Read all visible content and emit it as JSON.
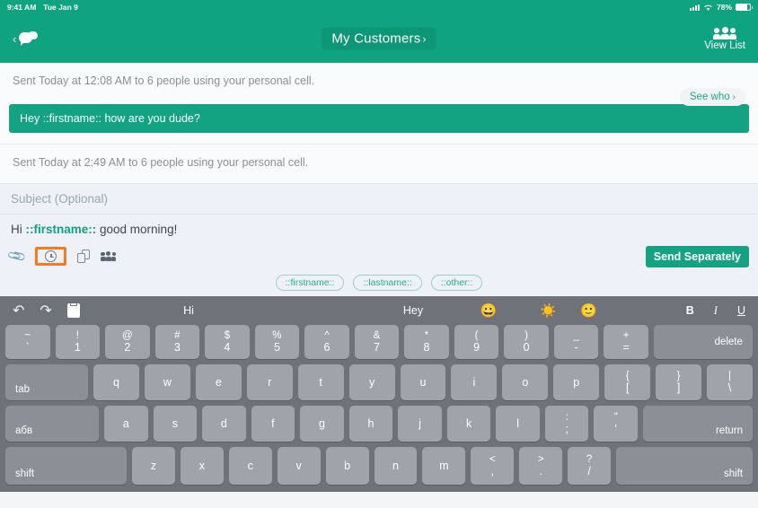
{
  "status_bar": {
    "time": "9:41 AM",
    "date": "Tue Jan 9",
    "battery_percent": "78%",
    "battery_level": 78,
    "signal_icon": "cellular-signal-icon",
    "wifi_icon": "wifi-icon"
  },
  "header": {
    "back_icon": "chevron-left-icon",
    "messages_icon": "chat-bubbles-icon",
    "title": "My Customers",
    "title_chevron": "›",
    "view_list_label": "View List",
    "view_list_icon": "people-group-icon",
    "accent_color": "#0fa37f"
  },
  "thread": {
    "entries": [
      {
        "sent_text": "Sent Today at 12:08 AM to 6 people using your personal cell.",
        "see_who_label": "See who",
        "see_who_chevron": "›",
        "message": "Hey ::firstname:: how are you dude?"
      },
      {
        "sent_text": "Sent Today at 2:49 AM to 6 people using your personal cell."
      }
    ]
  },
  "composer": {
    "subject_placeholder": "Subject (Optional)",
    "subject_value": "",
    "message_parts": {
      "before": "Hi ",
      "merge_field": "::firstname::",
      "after": " good morning!"
    },
    "tools": [
      {
        "name": "attach-icon",
        "label": "attach"
      },
      {
        "name": "schedule-clock-icon",
        "label": "schedule",
        "highlighted": true
      },
      {
        "name": "duplicate-icon",
        "label": "duplicate"
      },
      {
        "name": "recipients-group-icon",
        "label": "recipients"
      }
    ],
    "highlight_color": "#f47b20",
    "send_button_label": "Send Separately",
    "send_button_color": "#13a383",
    "merge_chips": [
      "::firstname::",
      "::lastname::",
      "::other::"
    ]
  },
  "keyboard": {
    "toolbar": {
      "undo_icon": "undo-arrow-icon",
      "redo_icon": "redo-arrow-icon",
      "paste_icon": "paste-clipboard-icon",
      "suggestions": [
        "Hi",
        "Hey"
      ],
      "emoji_suggestions": [
        "😀",
        "☀️",
        "🙂"
      ],
      "bold_label": "B",
      "italic_label": "I",
      "underline_label": "U"
    },
    "row_numbers": [
      {
        "top": "~",
        "bot": "`"
      },
      {
        "top": "!",
        "bot": "1"
      },
      {
        "top": "@",
        "bot": "2"
      },
      {
        "top": "#",
        "bot": "3"
      },
      {
        "top": "$",
        "bot": "4"
      },
      {
        "top": "%",
        "bot": "5"
      },
      {
        "top": "^",
        "bot": "6"
      },
      {
        "top": "&",
        "bot": "7"
      },
      {
        "top": "*",
        "bot": "8"
      },
      {
        "top": "(",
        "bot": "9"
      },
      {
        "top": ")",
        "bot": "0"
      },
      {
        "top": "_",
        "bot": "-"
      },
      {
        "top": "+",
        "bot": "="
      }
    ],
    "delete_label": "delete",
    "tab_label": "tab",
    "row_top": [
      {
        "bot": "q"
      },
      {
        "bot": "w"
      },
      {
        "bot": "e"
      },
      {
        "bot": "r"
      },
      {
        "bot": "t"
      },
      {
        "bot": "y"
      },
      {
        "bot": "u"
      },
      {
        "bot": "i"
      },
      {
        "bot": "o"
      },
      {
        "bot": "p"
      },
      {
        "top": "{",
        "bot": "["
      },
      {
        "top": "}",
        "bot": "]"
      },
      {
        "top": "|",
        "bot": "\\"
      }
    ],
    "lang_label": "абв",
    "row_home": [
      {
        "bot": "a"
      },
      {
        "bot": "s"
      },
      {
        "bot": "d"
      },
      {
        "bot": "f"
      },
      {
        "bot": "g"
      },
      {
        "bot": "h"
      },
      {
        "bot": "j"
      },
      {
        "bot": "k"
      },
      {
        "bot": "l"
      },
      {
        "top": ":",
        "bot": ";"
      },
      {
        "top": "\"",
        "bot": "'"
      }
    ],
    "return_label": "return",
    "shift_label": "shift",
    "row_bottom": [
      {
        "bot": "z"
      },
      {
        "bot": "x"
      },
      {
        "bot": "c"
      },
      {
        "bot": "v"
      },
      {
        "bot": "b"
      },
      {
        "bot": "n"
      },
      {
        "bot": "m"
      },
      {
        "top": "<",
        "bot": ","
      },
      {
        "top": ">",
        "bot": "."
      },
      {
        "top": "?",
        "bot": "/"
      }
    ]
  }
}
